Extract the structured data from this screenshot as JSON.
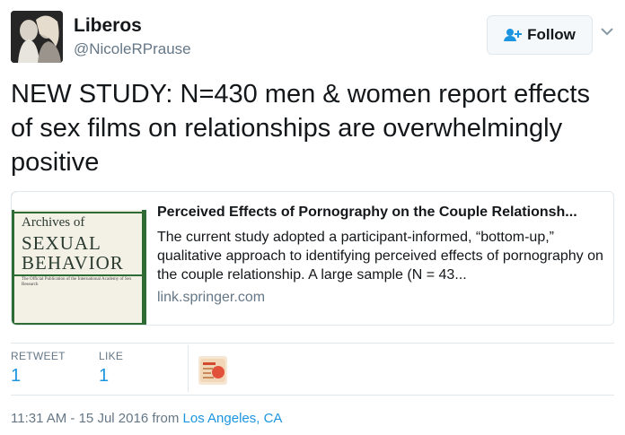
{
  "author": {
    "display_name": "Liberos",
    "handle": "@NicoleRPrause",
    "avatar_icon": "profile-photo"
  },
  "follow_button": {
    "label": "Follow",
    "icon": "add-user-icon",
    "icon_color": "#1b95e0"
  },
  "tweet": {
    "text": "NEW STUDY: N=430 men & women report effects of sex films on relationships are overwhelmingly positive"
  },
  "card": {
    "title": "Perceived Effects of Pornography on the Couple Relationsh...",
    "description": "The current study adopted a participant-informed, “bottom-up,” qualitative approach to identifying perceived effects of pornography on the couple relationship. A large sample (N = 43...",
    "domain": "link.springer.com",
    "thumbnail": {
      "line1": "Archives of",
      "line2": "SEXUAL",
      "line3": "BEHAVIOR",
      "subtitle": "The Official Publication of the International Academy of Sex Research"
    }
  },
  "stats": {
    "retweet_label": "RETWEET",
    "retweet_count": "1",
    "like_label": "LIKE",
    "like_count": "1"
  },
  "meta": {
    "timestamp": "11:31 AM - 15 Jul 2016",
    "from_text": "from",
    "location": "Los Angeles, CA"
  },
  "colors": {
    "link_blue": "#1b95e0",
    "text_dark": "#14171a",
    "text_gray": "#657786",
    "border": "#e1e8ed"
  }
}
